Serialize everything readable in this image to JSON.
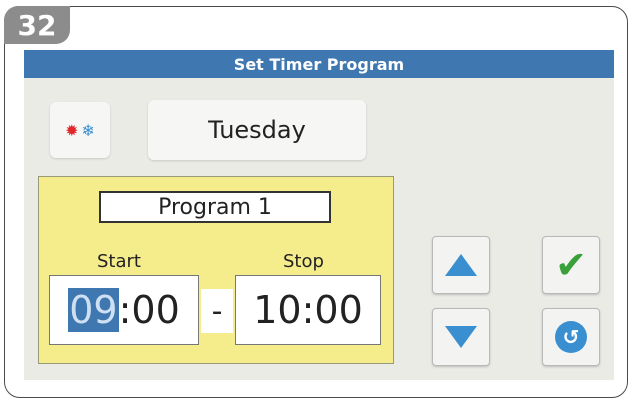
{
  "step_number": "32",
  "title": "Set Timer Program",
  "mode_icons": [
    "sun-icon",
    "snowflake-icon"
  ],
  "day": "Tuesday",
  "program": {
    "label": "Program 1",
    "start_label": "Start",
    "stop_label": "Stop",
    "start_hour": "09",
    "start_rest": ":00",
    "separator": "-",
    "stop_time": "10:00"
  },
  "buttons": {
    "up": "up-arrow-icon",
    "down": "down-arrow-icon",
    "confirm": "checkmark-icon",
    "back": "return-icon"
  },
  "colors": {
    "title_bar": "#3f77b0",
    "program_panel": "#f5ec8c",
    "arrow": "#3a8fd0",
    "check": "#3aa13a",
    "heat": "#e0262a",
    "cool": "#3a8fd0"
  }
}
